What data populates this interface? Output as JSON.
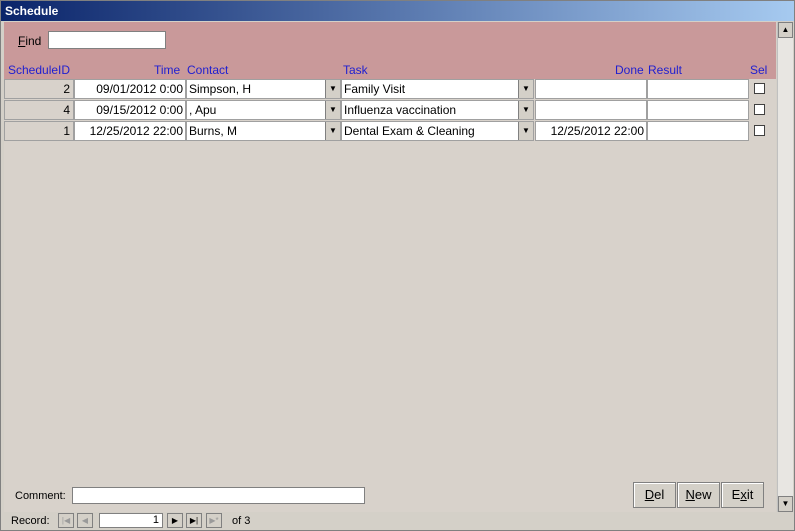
{
  "window": {
    "title": "Schedule"
  },
  "find": {
    "label_prefix": "F",
    "label_rest": "ind",
    "value": ""
  },
  "columns": {
    "schedule_id": "ScheduleID",
    "time": "Time",
    "contact": "Contact",
    "task": "Task",
    "done": "Done",
    "result": "Result",
    "sel": "Sel"
  },
  "rows": [
    {
      "id": "2",
      "time": "09/01/2012 0:00",
      "contact": "Simpson, H",
      "task": "Family Visit",
      "done": "",
      "result": "",
      "sel": false
    },
    {
      "id": "4",
      "time": "09/15/2012 0:00",
      "contact": ", Apu",
      "task": "Influenza vaccination",
      "done": "",
      "result": "",
      "sel": false
    },
    {
      "id": "1",
      "time": "12/25/2012 22:00",
      "contact": "Burns, M",
      "task": "Dental Exam & Cleaning",
      "done": "12/25/2012 22:00",
      "result": "",
      "sel": false
    }
  ],
  "comment": {
    "label": "Comment:",
    "value": ""
  },
  "buttons": {
    "del": {
      "prefix": "",
      "underlined": "D",
      "rest": "el"
    },
    "new": {
      "prefix": "",
      "underlined": "N",
      "rest": "ew"
    },
    "exit": {
      "prefix": "E",
      "underlined": "x",
      "rest": "it"
    }
  },
  "navigation": {
    "label": "Record:",
    "current": "1",
    "of_text": "of  3"
  },
  "colors": {
    "header": "#c9999a",
    "column_text": "#1f1fd0",
    "titlebar": "#0a246a"
  }
}
